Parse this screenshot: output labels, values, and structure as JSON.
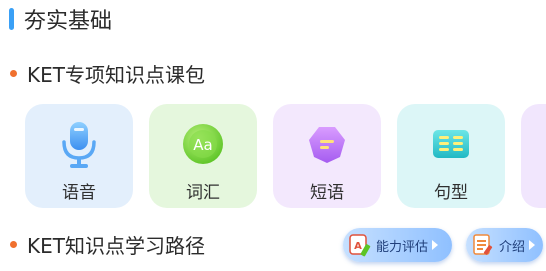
{
  "section": {
    "title": "夯实基础"
  },
  "package": {
    "title": "KET专项知识点课包"
  },
  "cards": [
    {
      "label": "语音",
      "icon": "microphone-icon"
    },
    {
      "label": "词汇",
      "icon": "vocabulary-icon"
    },
    {
      "label": "短语",
      "icon": "phrase-icon"
    },
    {
      "label": "句型",
      "icon": "sentence-pattern-icon"
    }
  ],
  "path": {
    "title": "KET知识点学习路径"
  },
  "buttons": {
    "assess_label": "能力评估",
    "intro_label": "介绍"
  },
  "colors": {
    "accent_blue": "#3aa0f6",
    "dot_orange": "#f0702e"
  }
}
